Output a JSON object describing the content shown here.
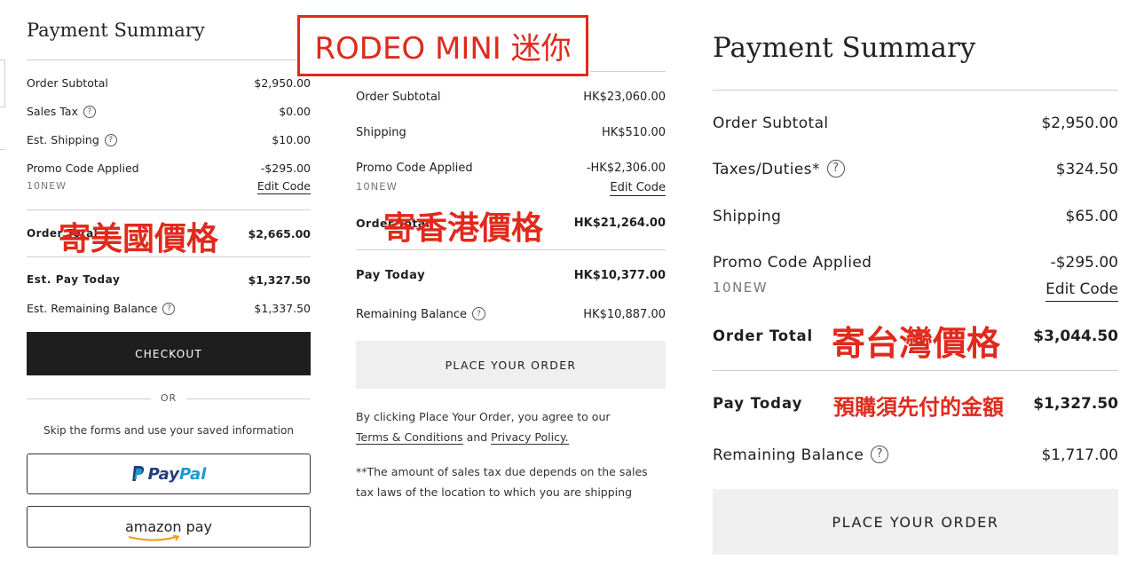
{
  "annotations": {
    "title": "RODEO MINI 迷你",
    "us_label": "寄美國價格",
    "hk_label": "寄香港價格",
    "tw_label": "寄台灣價格",
    "tw_pay_note": "預購須先付的金額",
    "accent_color": "#e02a1c"
  },
  "panel_us": {
    "heading": "Payment Summary",
    "rows": [
      {
        "label": "Order Subtotal",
        "value": "$2,950.00"
      },
      {
        "label": "Sales Tax",
        "value": "$0.00",
        "icon": "question-icon"
      },
      {
        "label": "Est. Shipping",
        "value": "$10.00",
        "icon": "question-icon"
      },
      {
        "label": "Promo Code Applied",
        "value": "-$295.00"
      }
    ],
    "promo_code": "10NEW",
    "edit_code": "Edit Code",
    "order_total_label": "Order Total",
    "order_total_value": "$2,665.00",
    "pay_today_label": "Est. Pay Today",
    "pay_today_value": "$1,327.50",
    "remaining_label": "Est. Remaining Balance",
    "remaining_value": "$1,337.50",
    "checkout": "CHECKOUT",
    "or": "OR",
    "skip_text": "Skip the forms and use your saved information",
    "paypal_a": "Pay",
    "paypal_b": "Pal",
    "amazon_pay": "amazon pay"
  },
  "panel_hk": {
    "rows": [
      {
        "label": "Order Subtotal",
        "value": "HK$23,060.00"
      },
      {
        "label": "Shipping",
        "value": "HK$510.00"
      },
      {
        "label": "Promo Code Applied",
        "value": "-HK$2,306.00"
      }
    ],
    "promo_code": "10NEW",
    "edit_code": "Edit Code",
    "order_total_label": "Order Total",
    "order_total_value": "HK$21,264.00",
    "pay_today_label": "Pay Today",
    "pay_today_value": "HK$10,377.00",
    "remaining_label": "Remaining Balance",
    "remaining_value": "HK$10,887.00",
    "place_order": "PLACE YOUR ORDER",
    "agree_prefix": "By clicking Place Your Order, you agree to our",
    "terms": "Terms & Conditions",
    "and": "and",
    "privacy": "Privacy Policy.",
    "tax_note": "**The amount of sales tax due depends on the sales tax laws of the location to which you are shipping"
  },
  "panel_tw": {
    "heading": "Payment Summary",
    "rows": [
      {
        "label": "Order Subtotal",
        "value": "$2,950.00"
      },
      {
        "label": "Taxes/Duties*",
        "value": "$324.50",
        "icon": "question-icon"
      },
      {
        "label": "Shipping",
        "value": "$65.00"
      },
      {
        "label": "Promo Code Applied",
        "value": "-$295.00"
      }
    ],
    "promo_code": "10NEW",
    "edit_code": "Edit Code",
    "order_total_label": "Order Total",
    "order_total_value": "$3,044.50",
    "pay_today_label": "Pay Today",
    "pay_today_value": "$1,327.50",
    "remaining_label": "Remaining Balance",
    "remaining_value": "$1,717.00",
    "place_order": "PLACE YOUR ORDER"
  }
}
